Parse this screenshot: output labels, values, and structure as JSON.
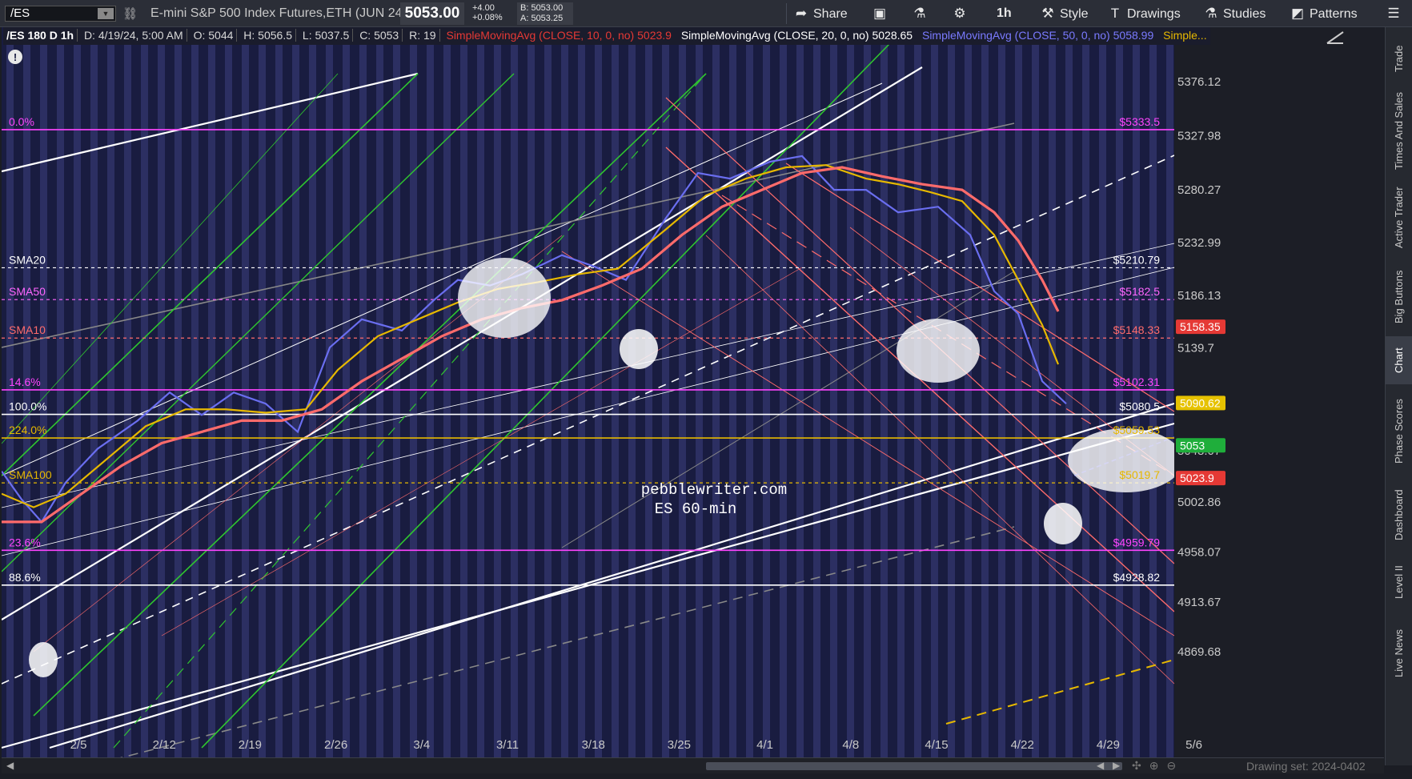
{
  "toolbar": {
    "symbol": "/ES",
    "instrument_title": "E-mini S&P 500 Index Futures,ETH (JUN 24)",
    "last_price": "5053.00",
    "change": "+4.00",
    "change_pct": "+0.08%",
    "bid": "B: 5053.00",
    "ask": "A: 5053.25",
    "share_label": "Share",
    "timeframe_label": "1h",
    "style_label": "Style",
    "drawings_label": "Drawings",
    "studies_label": "Studies",
    "patterns_label": "Patterns"
  },
  "header": {
    "symbol_period": "/ES 180 D 1h",
    "date": "D: 4/19/24, 5:00 AM",
    "open": "O: 5044",
    "high": "H: 5056.5",
    "low": "L: 5037.5",
    "close": "C: 5053",
    "range": "R: 19",
    "sma10_label": "SimpleMovingAvg (CLOSE, 10, 0, no)",
    "sma10_value": "5023.9",
    "sma20_label": "SimpleMovingAvg (CLOSE, 20, 0, no)",
    "sma20_value": "5028.65",
    "sma50_label": "SimpleMovingAvg (CLOSE, 50, 0, no)",
    "sma50_value": "5058.99",
    "more_label": "Simple..."
  },
  "right_rail": [
    "Trade",
    "Times And Sales",
    "Active Trader",
    "Big Buttons",
    "Chart",
    "Phase Scores",
    "Dashboard",
    "Level II",
    "Live News"
  ],
  "footer": {
    "drawing_set": "Drawing set: 2024-0402"
  },
  "watermark": {
    "line1": "pebblewriter.com",
    "line2": "ES 60-min"
  },
  "chart_data": {
    "type": "line",
    "y_ticks": [
      "5376.12",
      "5327.98",
      "5280.27",
      "5232.99",
      "5186.13",
      "5139.7",
      "5048.07",
      "5002.86",
      "4958.07",
      "4913.67",
      "4869.68"
    ],
    "x_ticks": [
      "2/5",
      "2/12",
      "2/19",
      "2/26",
      "3/4",
      "3/11",
      "3/18",
      "3/25",
      "4/1",
      "4/8",
      "4/15",
      "4/22",
      "4/29",
      "5/6"
    ],
    "ylim": [
      4869.68,
      5376.12
    ],
    "price_badges": [
      {
        "value": "5158.35",
        "color": "#e53935"
      },
      {
        "value": "5090.62",
        "color": "#e6c200"
      },
      {
        "value": "5053",
        "color": "#1fae3b"
      },
      {
        "value": "5023.9",
        "color": "#e53935"
      }
    ],
    "levels": [
      {
        "y": 5333.5,
        "left": "0.0%",
        "right": "$5333.5",
        "color": "#ff44ff",
        "style": "solid"
      },
      {
        "y": 5210.79,
        "left": "SMA20",
        "right": "$5210.79",
        "color": "#ffffff",
        "style": "dashed"
      },
      {
        "y": 5182.5,
        "left": "SMA50",
        "right": "$5182.5",
        "color": "#ff66ff",
        "style": "dashed"
      },
      {
        "y": 5148.33,
        "left": "SMA10",
        "right": "$5148.33",
        "color": "#ff6b6b",
        "style": "dashed"
      },
      {
        "y": 5102.31,
        "left": "14.6%",
        "right": "$5102.31",
        "color": "#ff44ff",
        "style": "solid"
      },
      {
        "y": 5080.5,
        "left": "100.0%",
        "right": "$5080.5",
        "color": "#ffffff",
        "style": "solid"
      },
      {
        "y": 5059.53,
        "left": "224.0%",
        "right": "$5059.53",
        "color": "#e6b800",
        "style": "solid"
      },
      {
        "y": 5019.7,
        "left": "SMA100",
        "right": "$5019.7",
        "color": "#e6b800",
        "style": "dashed"
      },
      {
        "y": 4959.79,
        "left": "23.6%",
        "right": "$4959.79",
        "color": "#ff44ff",
        "style": "solid"
      },
      {
        "y": 4928.82,
        "left": "88.6%",
        "right": "$4928.82",
        "color": "#ffffff",
        "style": "solid"
      }
    ],
    "series": [
      {
        "name": "SMA20",
        "color": "#6a6ef0",
        "values": [
          [
            0,
            5030
          ],
          [
            25,
            5005
          ],
          [
            50,
            4985
          ],
          [
            80,
            5020
          ],
          [
            120,
            5050
          ],
          [
            170,
            5075
          ],
          [
            210,
            5100
          ],
          [
            250,
            5080
          ],
          [
            290,
            5100
          ],
          [
            330,
            5090
          ],
          [
            370,
            5065
          ],
          [
            410,
            5140
          ],
          [
            450,
            5165
          ],
          [
            500,
            5155
          ],
          [
            540,
            5182
          ],
          [
            570,
            5200
          ],
          [
            610,
            5195
          ],
          [
            650,
            5205
          ],
          [
            700,
            5222
          ],
          [
            740,
            5212
          ],
          [
            780,
            5200
          ],
          [
            830,
            5255
          ],
          [
            870,
            5295
          ],
          [
            910,
            5290
          ],
          [
            960,
            5305
          ],
          [
            1000,
            5310
          ],
          [
            1040,
            5280
          ],
          [
            1080,
            5280
          ],
          [
            1120,
            5260
          ],
          [
            1170,
            5265
          ],
          [
            1210,
            5240
          ],
          [
            1240,
            5190
          ],
          [
            1270,
            5170
          ],
          [
            1300,
            5110
          ],
          [
            1330,
            5090
          ]
        ]
      },
      {
        "name": "SMA50",
        "color": "#e6b800",
        "values": [
          [
            0,
            5010
          ],
          [
            40,
            4998
          ],
          [
            80,
            5010
          ],
          [
            130,
            5040
          ],
          [
            180,
            5070
          ],
          [
            230,
            5085
          ],
          [
            280,
            5085
          ],
          [
            330,
            5082
          ],
          [
            380,
            5085
          ],
          [
            420,
            5120
          ],
          [
            470,
            5150
          ],
          [
            520,
            5165
          ],
          [
            570,
            5180
          ],
          [
            620,
            5192
          ],
          [
            670,
            5198
          ],
          [
            720,
            5205
          ],
          [
            770,
            5210
          ],
          [
            830,
            5245
          ],
          [
            880,
            5275
          ],
          [
            930,
            5290
          ],
          [
            980,
            5300
          ],
          [
            1030,
            5302
          ],
          [
            1080,
            5290
          ],
          [
            1120,
            5285
          ],
          [
            1160,
            5278
          ],
          [
            1200,
            5270
          ],
          [
            1240,
            5240
          ],
          [
            1270,
            5200
          ],
          [
            1300,
            5160
          ],
          [
            1320,
            5125
          ]
        ]
      },
      {
        "name": "SMA100",
        "color": "#ff6b6b",
        "values": [
          [
            0,
            4985
          ],
          [
            50,
            4985
          ],
          [
            100,
            5010
          ],
          [
            150,
            5035
          ],
          [
            200,
            5055
          ],
          [
            250,
            5065
          ],
          [
            300,
            5075
          ],
          [
            350,
            5075
          ],
          [
            400,
            5085
          ],
          [
            450,
            5110
          ],
          [
            500,
            5130
          ],
          [
            550,
            5150
          ],
          [
            600,
            5165
          ],
          [
            650,
            5175
          ],
          [
            700,
            5182
          ],
          [
            750,
            5195
          ],
          [
            800,
            5210
          ],
          [
            850,
            5240
          ],
          [
            900,
            5265
          ],
          [
            950,
            5280
          ],
          [
            1000,
            5295
          ],
          [
            1050,
            5300
          ],
          [
            1100,
            5292
          ],
          [
            1150,
            5285
          ],
          [
            1200,
            5280
          ],
          [
            1240,
            5260
          ],
          [
            1270,
            5235
          ],
          [
            1300,
            5200
          ],
          [
            1320,
            5172
          ]
        ]
      }
    ]
  }
}
